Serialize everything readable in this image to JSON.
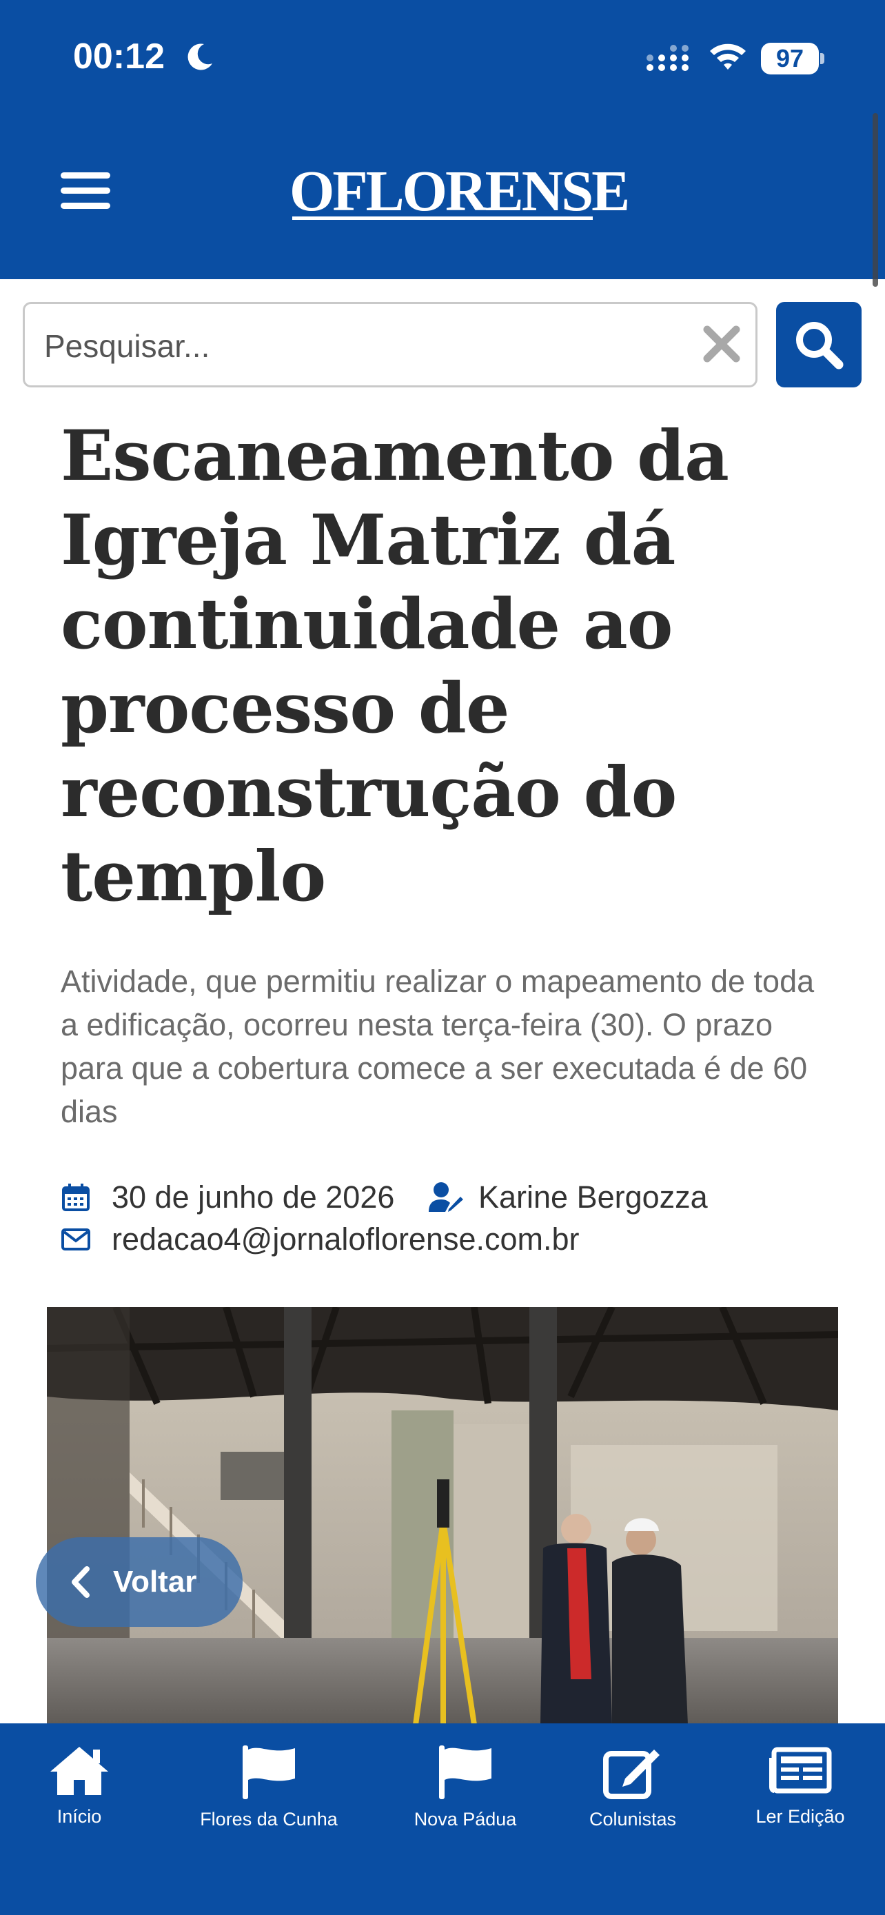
{
  "status_bar": {
    "time": "00:12",
    "battery": "97"
  },
  "header": {
    "logo_text": "OFLORENSE"
  },
  "search": {
    "placeholder": "Pesquisar..."
  },
  "article": {
    "headline": "Escaneamento da Igreja Matriz dá continuidade ao processo de reconstrução do templo",
    "subtitle": "Atividade, que permitiu realizar o mapeamento de toda a edificação, ocorreu nesta terça-feira (30). O prazo para que a cobertura comece a ser executada é de 60 dias",
    "date": "30 de junho de 2026",
    "author": "Karine Bergozza",
    "email": "redacao4@jornaloflorense.com.br"
  },
  "back_button": {
    "label": "Voltar"
  },
  "tabs": [
    {
      "label": "Início",
      "icon": "home-icon"
    },
    {
      "label": "Flores da Cunha",
      "icon": "flag-icon"
    },
    {
      "label": "Nova Pádua",
      "icon": "flag-icon"
    },
    {
      "label": "Colunistas",
      "icon": "edit-icon"
    },
    {
      "label": "Ler Edição",
      "icon": "newspaper-icon"
    }
  ],
  "colors": {
    "brand_blue": "#0a4ea3",
    "text_dark": "#2c2c2c",
    "text_muted": "#6b6b6b"
  }
}
